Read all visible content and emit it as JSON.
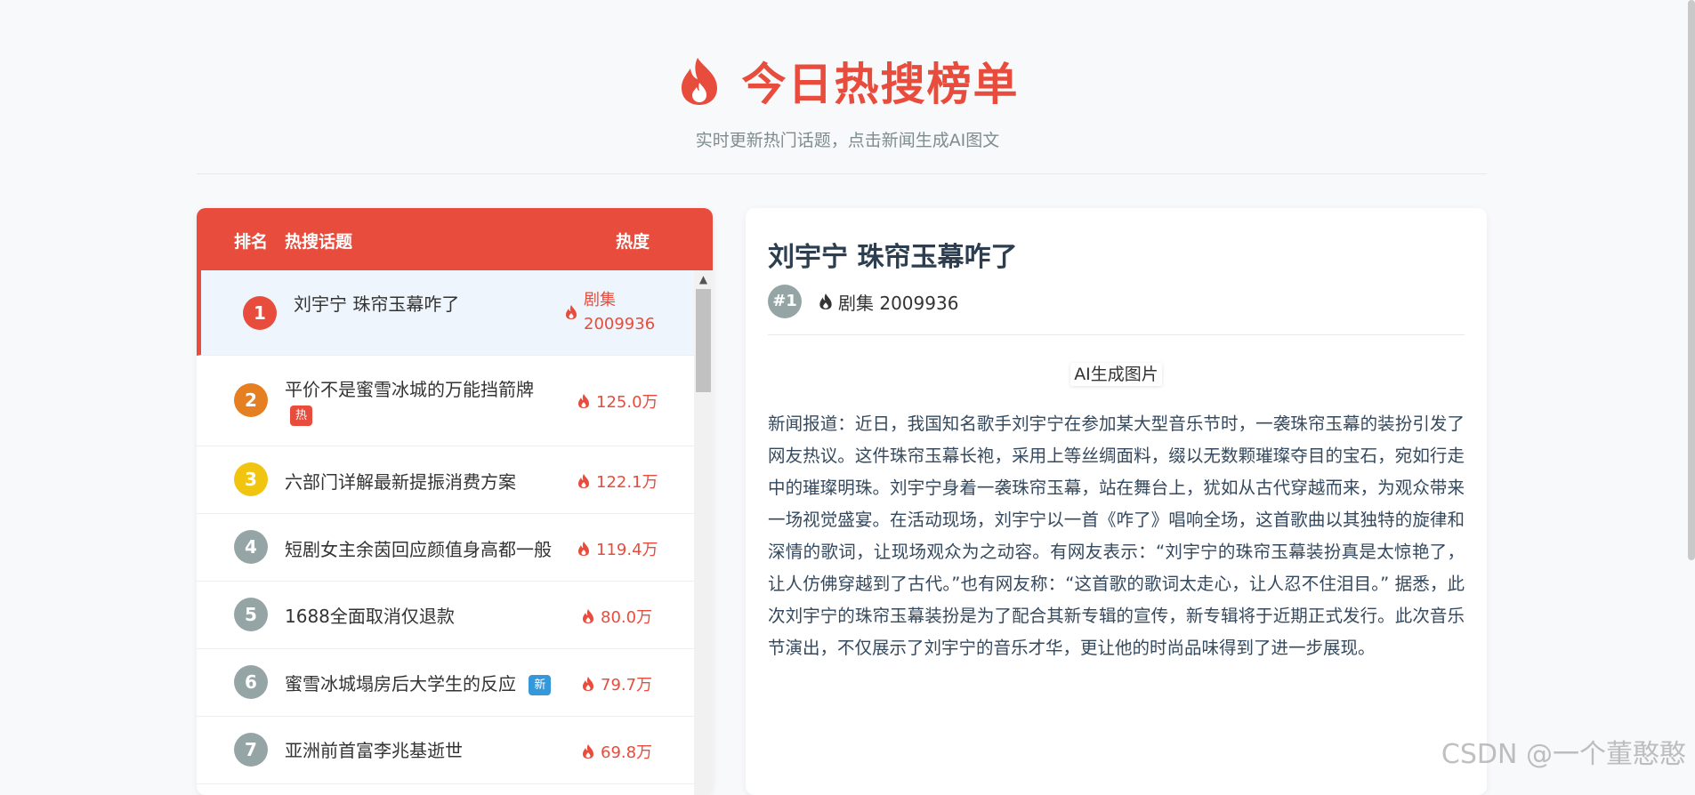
{
  "header": {
    "title": "今日热搜榜单",
    "subtitle": "实时更新热门话题，点击新闻生成AI图文",
    "icon": "fire-icon"
  },
  "table": {
    "col_rank": "排名",
    "col_topic": "热搜话题",
    "col_heat": "热度",
    "rows": [
      {
        "rank": "1",
        "topic": "刘宇宁 珠帘玉幕咋了",
        "heat_line1": "剧集",
        "heat_line2": "2009936",
        "tag": "",
        "badge_color": "#e74c3c"
      },
      {
        "rank": "2",
        "topic": "平价不是蜜雪冰城的万能挡箭牌",
        "heat": "125.0万",
        "tag": "热",
        "badge_color": "#e67e22"
      },
      {
        "rank": "3",
        "topic": "六部门详解最新提振消费方案",
        "heat": "122.1万",
        "tag": "",
        "badge_color": "#f1c40f"
      },
      {
        "rank": "4",
        "topic": "短剧女主余茵回应颜值身高都一般",
        "heat": "119.4万",
        "tag": "",
        "badge_color": "#95a5a6"
      },
      {
        "rank": "5",
        "topic": "1688全面取消仅退款",
        "heat": "80.0万",
        "tag": "",
        "badge_color": "#95a5a6"
      },
      {
        "rank": "6",
        "topic": "蜜雪冰城塌房后大学生的反应",
        "heat": "79.7万",
        "tag": "新",
        "badge_color": "#95a5a6"
      },
      {
        "rank": "7",
        "topic": "亚洲前首富李兆基逝世",
        "heat": "69.8万",
        "tag": "",
        "badge_color": "#95a5a6"
      }
    ]
  },
  "detail": {
    "title": "刘宇宁 珠帘玉幕咋了",
    "rank": "#1",
    "heat": "剧集 2009936",
    "image_caption": "AI生成图片",
    "article": "新闻报道：近日，我国知名歌手刘宇宁在参加某大型音乐节时，一袭珠帘玉幕的装扮引发了网友热议。这件珠帘玉幕长袍，采用上等丝绸面料，缀以无数颗璀璨夺目的宝石，宛如行走中的璀璨明珠。刘宇宁身着一袭珠帘玉幕，站在舞台上，犹如从古代穿越而来，为观众带来一场视觉盛宴。在活动现场，刘宇宁以一首《咋了》唱响全场，这首歌曲以其独特的旋律和深情的歌词，让现场观众为之动容。有网友表示：“刘宇宁的珠帘玉幕装扮真是太惊艳了，让人仿佛穿越到了古代。”也有网友称：“这首歌的歌词太走心，让人忍不住泪目。” 据悉，此次刘宇宁的珠帘玉幕装扮是为了配合其新专辑的宣传，新专辑将于近期正式发行。此次音乐节演出，不仅展示了刘宇宁的音乐才华，更让他的时尚品味得到了进一步展现。"
  },
  "watermark": "CSDN @一个董憨憨",
  "colors": {
    "accent": "#e74c3c",
    "new_tag": "#3498db"
  }
}
